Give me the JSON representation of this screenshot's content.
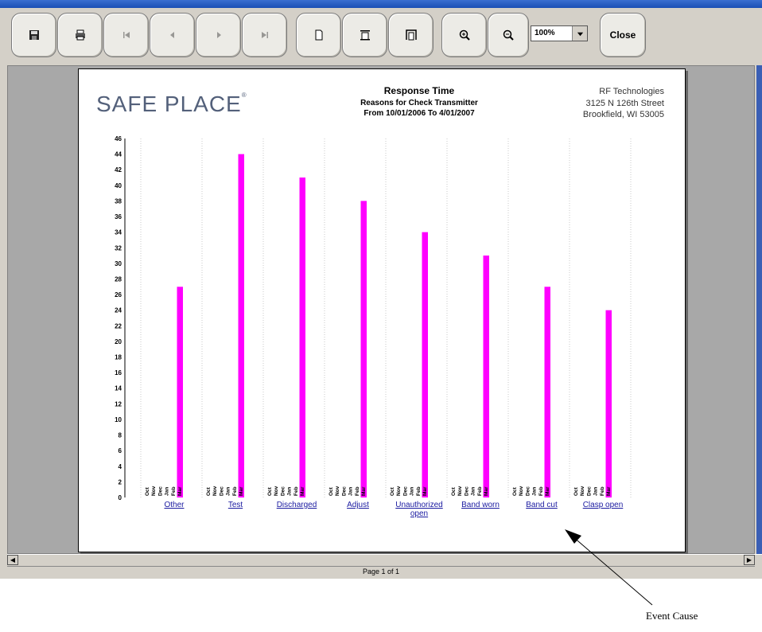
{
  "toolbar": {
    "zoom_value": "100%",
    "close_label": "Close"
  },
  "report": {
    "logo_text": "SAFE PLACE",
    "logo_mark": "®",
    "title": "Response Time",
    "subtitle": "Reasons for Check Transmitter",
    "date_range": "From 10/01/2006 To 4/01/2007",
    "company": "RF Technologies",
    "address1": "3125 N 126th Street",
    "address2": "Brookfield, WI 53005"
  },
  "status": {
    "page_text": "Page 1 of 1"
  },
  "annotation": {
    "label": "Event Cause"
  },
  "colors": {
    "bar": "#ff00ff",
    "toolbar_bg": "#d4d0c8",
    "link": "#1a1aa0"
  },
  "chart_data": {
    "type": "bar",
    "y_ticks": [
      0,
      2,
      4,
      6,
      8,
      10,
      12,
      14,
      16,
      18,
      20,
      22,
      24,
      26,
      28,
      30,
      32,
      34,
      36,
      38,
      40,
      42,
      44,
      46
    ],
    "ylim": [
      0,
      46
    ],
    "months": [
      "Oct",
      "Nov",
      "Dec",
      "Jan",
      "Feb",
      "Mar"
    ],
    "groups": [
      {
        "label": [
          "Other"
        ],
        "values": [
          0,
          0,
          0,
          0,
          0,
          27
        ]
      },
      {
        "label": [
          "Test"
        ],
        "values": [
          0,
          0,
          0,
          0,
          0,
          44
        ]
      },
      {
        "label": [
          "Discharged"
        ],
        "values": [
          0,
          0,
          0,
          0,
          0,
          41
        ]
      },
      {
        "label": [
          "Adjust"
        ],
        "values": [
          0,
          0,
          0,
          0,
          0,
          38
        ]
      },
      {
        "label": [
          "Unauthorized",
          "open"
        ],
        "values": [
          0,
          0,
          0,
          0,
          0,
          34
        ]
      },
      {
        "label": [
          "Band worn"
        ],
        "values": [
          0,
          0,
          0,
          0,
          0,
          31
        ]
      },
      {
        "label": [
          "Band cut"
        ],
        "values": [
          0,
          0,
          0,
          0,
          0,
          27
        ]
      },
      {
        "label": [
          "Clasp open"
        ],
        "values": [
          0,
          0,
          0,
          0,
          0,
          24
        ]
      }
    ]
  }
}
